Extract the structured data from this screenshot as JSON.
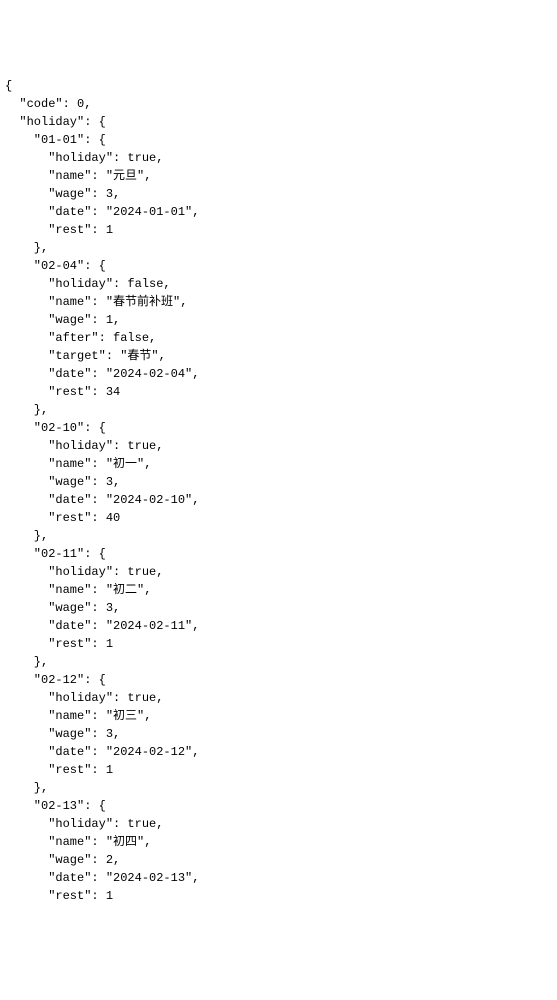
{
  "json": {
    "code": 0,
    "holiday": {
      "01-01": {
        "holiday": true,
        "name": "元旦",
        "wage": 3,
        "date": "2024-01-01",
        "rest": 1
      },
      "02-04": {
        "holiday": false,
        "name": "春节前补班",
        "wage": 1,
        "after": false,
        "target": "春节",
        "date": "2024-02-04",
        "rest": 34
      },
      "02-10": {
        "holiday": true,
        "name": "初一",
        "wage": 3,
        "date": "2024-02-10",
        "rest": 40
      },
      "02-11": {
        "holiday": true,
        "name": "初二",
        "wage": 3,
        "date": "2024-02-11",
        "rest": 1
      },
      "02-12": {
        "holiday": true,
        "name": "初三",
        "wage": 3,
        "date": "2024-02-12",
        "rest": 1
      },
      "02-13": {
        "holiday": true,
        "name": "初四",
        "wage": 2,
        "date": "2024-02-13",
        "rest": 1
      }
    }
  },
  "text": "{\n  \"code\": 0,\n  \"holiday\": {\n    \"01-01\": {\n      \"holiday\": true,\n      \"name\": \"元旦\",\n      \"wage\": 3,\n      \"date\": \"2024-01-01\",\n      \"rest\": 1\n    },\n    \"02-04\": {\n      \"holiday\": false,\n      \"name\": \"春节前补班\",\n      \"wage\": 1,\n      \"after\": false,\n      \"target\": \"春节\",\n      \"date\": \"2024-02-04\",\n      \"rest\": 34\n    },\n    \"02-10\": {\n      \"holiday\": true,\n      \"name\": \"初一\",\n      \"wage\": 3,\n      \"date\": \"2024-02-10\",\n      \"rest\": 40\n    },\n    \"02-11\": {\n      \"holiday\": true,\n      \"name\": \"初二\",\n      \"wage\": 3,\n      \"date\": \"2024-02-11\",\n      \"rest\": 1\n    },\n    \"02-12\": {\n      \"holiday\": true,\n      \"name\": \"初三\",\n      \"wage\": 3,\n      \"date\": \"2024-02-12\",\n      \"rest\": 1\n    },\n    \"02-13\": {\n      \"holiday\": true,\n      \"name\": \"初四\",\n      \"wage\": 2,\n      \"date\": \"2024-02-13\",\n      \"rest\": 1"
}
